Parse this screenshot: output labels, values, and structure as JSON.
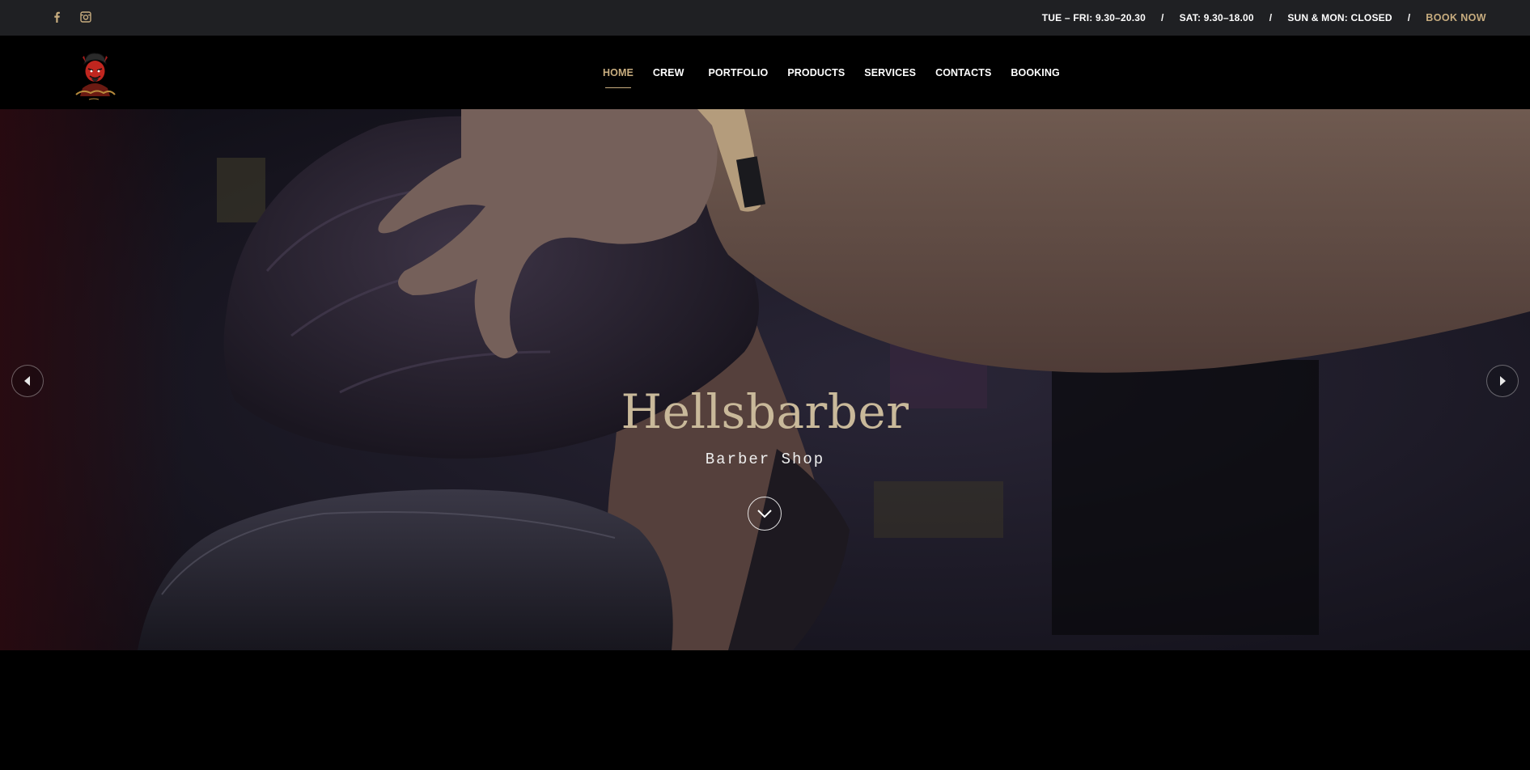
{
  "topbar": {
    "social": [
      {
        "icon": "facebook-icon",
        "label": "f"
      },
      {
        "icon": "instagram-icon",
        "label": ""
      }
    ],
    "hours": [
      "TUE – FRI: 9.30–20.30",
      "SAT: 9.30–18.00",
      "SUN & MON: CLOSED"
    ],
    "separator": "/",
    "book_now": "BOOK NOW"
  },
  "nav": {
    "items": [
      {
        "label": "HOME",
        "active": true
      },
      {
        "label": "CREW",
        "active": false
      },
      {
        "label": "PORTFOLIO",
        "active": false
      },
      {
        "label": "PRODUCTS",
        "active": false
      },
      {
        "label": "SERVICES",
        "active": false
      },
      {
        "label": "CONTACTS",
        "active": false
      },
      {
        "label": "BOOKING",
        "active": false
      }
    ]
  },
  "hero": {
    "title": "Hellsbarber",
    "subtitle": "Barber Shop"
  },
  "colors": {
    "accent": "#c8ad7f",
    "topbar_bg": "#1f2023",
    "nav_bg": "#000000"
  }
}
